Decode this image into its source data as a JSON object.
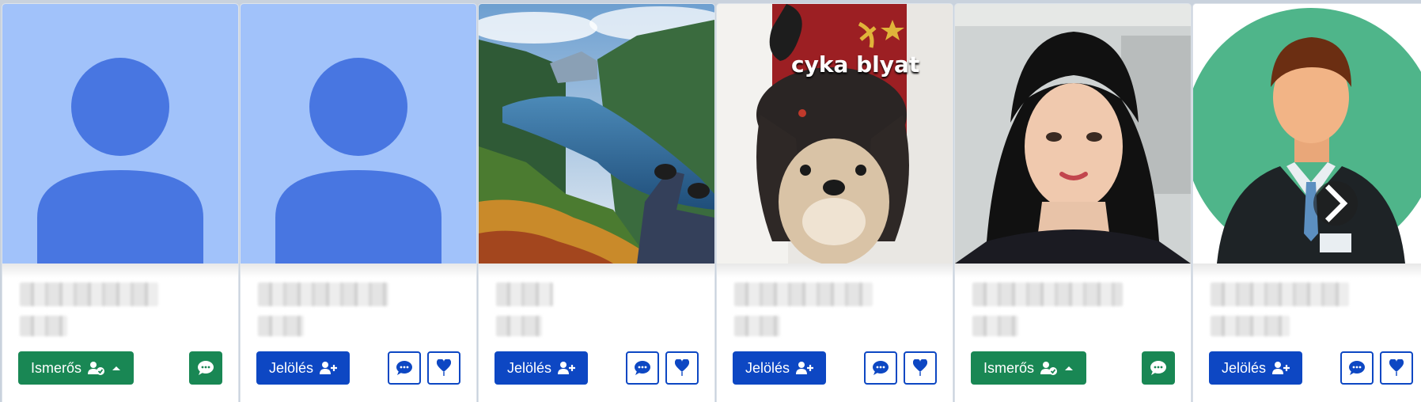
{
  "cards": [
    {
      "photo_type": "placeholder-avatar",
      "action_label": "Ismerős",
      "action_style": "friend",
      "has_heart": false
    },
    {
      "photo_type": "placeholder-avatar",
      "action_label": "Jelölés",
      "action_style": "request",
      "has_heart": true
    },
    {
      "photo_type": "fjord-landscape",
      "action_label": "Jelölés",
      "action_style": "request",
      "has_heart": true
    },
    {
      "photo_type": "dog-in-ushanka-meme",
      "meme_text": "cyka blyat",
      "action_label": "Jelölés",
      "action_style": "request",
      "has_heart": true
    },
    {
      "photo_type": "woman-portrait",
      "action_label": "Ismerős",
      "action_style": "friend",
      "has_heart": false
    },
    {
      "photo_type": "pixel-businessman-avatar",
      "action_label": "Jelölés",
      "action_style": "request",
      "has_heart": true
    }
  ],
  "colors": {
    "friend_green": "#198754",
    "request_blue": "#0d47c3",
    "placeholder_bg": "#a1c2fa",
    "placeholder_fg": "#4876e1"
  },
  "carousel": {
    "next_icon": "chevron-right-icon"
  }
}
